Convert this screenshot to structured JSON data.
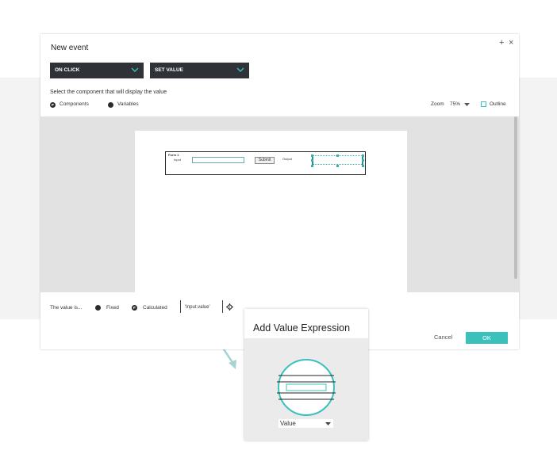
{
  "dialog": {
    "title": "New event",
    "controls": {
      "add": "+",
      "close": "×"
    },
    "event_dropdown": "ON CLICK",
    "action_dropdown": "SET VALUE",
    "instruction": "Select the component that will display the value",
    "options": {
      "components": "Components",
      "variables": "Variables"
    },
    "zoom": {
      "label": "Zoom",
      "value": "75%"
    },
    "outline_label": "Outline"
  },
  "form_preview": {
    "title": "Form 1",
    "input_label": "Input",
    "submit_label": "Submit",
    "output_label": "Output"
  },
  "value_row": {
    "label": "The value is...",
    "fixed": "Fixed",
    "calculated": "Calculated",
    "expression": "'Input.value'"
  },
  "actions": {
    "cancel": "Cancel",
    "ok": "OK"
  },
  "popup": {
    "title": "Add Value Expression",
    "select_value": "Value"
  },
  "colors": {
    "accent": "#3bc0bc",
    "dark": "#2f3236"
  },
  "icons": [
    "chevron-down-icon",
    "gear-icon",
    "plus-icon",
    "close-icon",
    "arrow-icon"
  ]
}
